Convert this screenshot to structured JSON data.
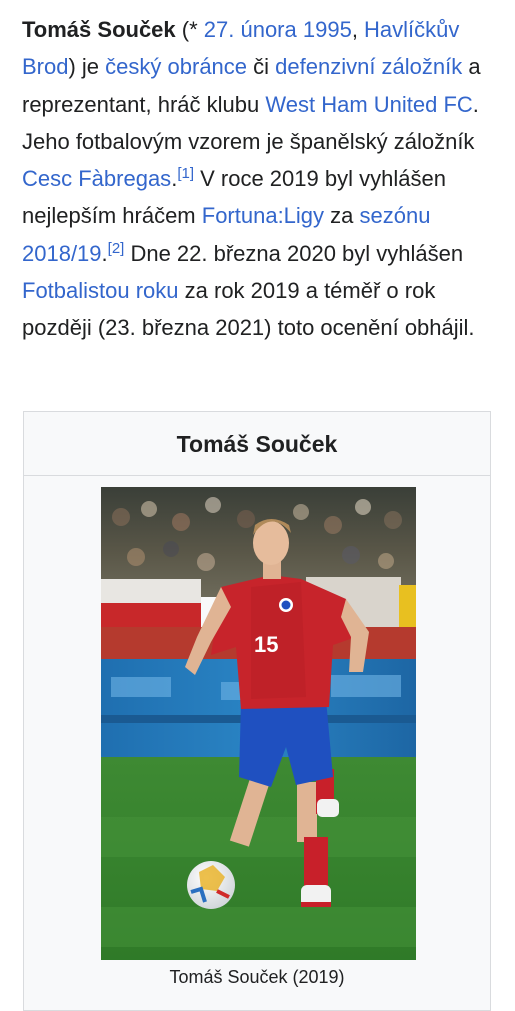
{
  "article": {
    "subject_name": "Tomáš Souček",
    "t_open": " (* ",
    "link_birth_date": "27. února 1995",
    "t_comma": ", ",
    "link_birthplace": "Havlíčkův Brod",
    "t_je": ") je ",
    "link_nationality": "český obránce",
    "t_ci": " či ",
    "link_position": "defenzivní záložník",
    "t_a": " a reprezentant, hráč klubu ",
    "link_club": "West Ham United FC",
    "t_idol": ". Jeho fotbalovým vzorem je španělský záložník ",
    "link_idol": "Cesc Fàbregas",
    "t_dot": ".",
    "ref1": "[1]",
    "t_2019": " V roce 2019 byl vyhlášen nejlepším hráčem ",
    "link_league": "Fortuna:Ligy",
    "t_za": " za ",
    "link_season": "sezónu 2018/19",
    "ref2": "[2]",
    "t_march": " Dne 22. března 2020 byl vyhlášen ",
    "link_award": "Fotbalistou roku",
    "t_end": " za rok 2019 a téměř o rok později (23. března 2021) toto ocenění obhájil."
  },
  "infobox": {
    "title": "Tomáš Souček",
    "photo_caption": "Tomáš Souček (2019)",
    "photo_alt": "Player photo"
  },
  "colors": {
    "link": "#3366cc",
    "text": "#202122",
    "infobox_bg": "#f8f9fa",
    "infobox_border": "#d9dbde"
  }
}
